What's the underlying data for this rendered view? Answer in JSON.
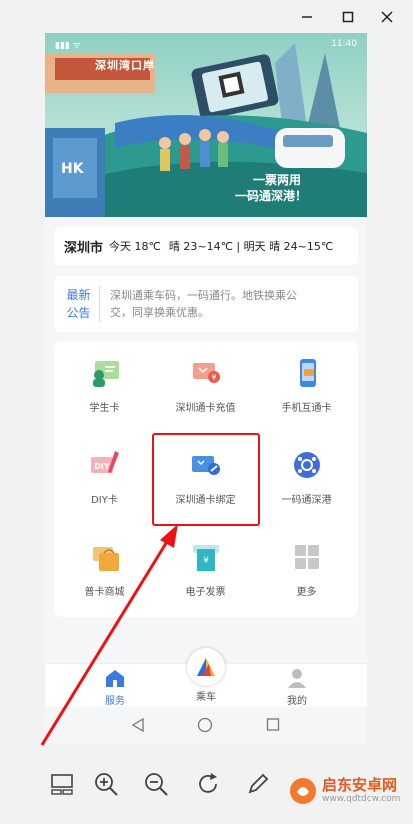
{
  "status_bar": {
    "time": "11:40"
  },
  "banner": {
    "signage": "深圳湾口岸",
    "slogan_line1": "一票两用",
    "slogan_line2": "一码通深港！",
    "hk_badge": "HK"
  },
  "weather": {
    "city": "深圳市",
    "today": "今天 18℃",
    "forecast": "晴 23~14℃ | 明天 晴 24~15℃"
  },
  "notice": {
    "tag_line1": "最新",
    "tag_line2": "公告",
    "text_line1": "深圳通乘车码，一码通行。地铁换乘公",
    "text_line2": "交，同享换乘优惠。"
  },
  "services": [
    {
      "label": "学生卡",
      "icon": "student-card-icon"
    },
    {
      "label": "深圳通卡充值",
      "icon": "card-topup-icon"
    },
    {
      "label": "手机互通卡",
      "icon": "phone-card-icon"
    },
    {
      "label": "DIY卡",
      "icon": "diy-card-icon"
    },
    {
      "label": "深圳通卡绑定",
      "icon": "card-bind-icon"
    },
    {
      "label": "一码通深港",
      "icon": "sz-hk-code-icon"
    },
    {
      "label": "普卡商城",
      "icon": "card-shop-icon"
    },
    {
      "label": "电子发票",
      "icon": "e-invoice-icon"
    },
    {
      "label": "更多",
      "icon": "more-grid-icon"
    }
  ],
  "tabs": {
    "service": "服务",
    "ride": "乘车",
    "mine": "我的"
  },
  "colors": {
    "accent_blue": "#3a7be0",
    "highlight_red": "#e11111",
    "teal": "#2c9a8f"
  },
  "watermark": {
    "name": "启东安卓网",
    "url": "www.qdtdcw.com"
  }
}
